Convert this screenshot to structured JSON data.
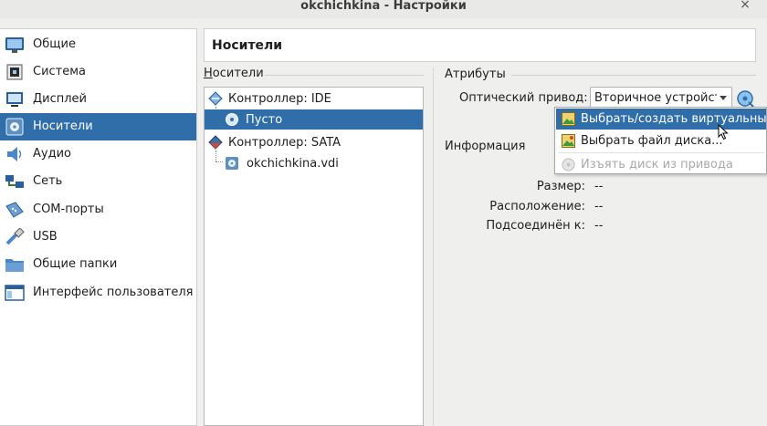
{
  "window": {
    "title": "okchichkina - Настройки",
    "close_glyph": "×"
  },
  "sidebar": {
    "items": [
      {
        "label": "Общие",
        "icon": "general-icon"
      },
      {
        "label": "Система",
        "icon": "system-icon"
      },
      {
        "label": "Дисплей",
        "icon": "display-icon"
      },
      {
        "label": "Носители",
        "icon": "storage-icon",
        "selected": true
      },
      {
        "label": "Аудио",
        "icon": "audio-icon"
      },
      {
        "label": "Сеть",
        "icon": "network-icon"
      },
      {
        "label": "COM-порты",
        "icon": "serial-ports-icon"
      },
      {
        "label": "USB",
        "icon": "usb-icon"
      },
      {
        "label": "Общие папки",
        "icon": "shared-folders-icon"
      },
      {
        "label": "Интерфейс пользователя",
        "icon": "user-interface-icon"
      }
    ]
  },
  "page": {
    "title": "Носители"
  },
  "storage": {
    "section_label": "Носители",
    "tree": [
      {
        "label": "Контроллер: IDE",
        "type": "controller",
        "icon": "ide-controller-icon"
      },
      {
        "label": "Пусто",
        "type": "attachment",
        "icon": "optical-disc-icon",
        "selected": true
      },
      {
        "label": "Контроллер: SATA",
        "type": "controller",
        "icon": "sata-controller-icon"
      },
      {
        "label": "okchichkina.vdi",
        "type": "attachment",
        "icon": "hard-disk-icon"
      }
    ]
  },
  "attributes": {
    "section_label": "Атрибуты",
    "optical_drive_label": "Оптический привод:",
    "optical_drive_value": "Вторичное устройство IDE"
  },
  "dropdown_menu": {
    "items": [
      {
        "label": "Выбрать/создать виртуальный оптический диск...",
        "highlighted": true,
        "enabled": true,
        "icon": "choose-disk-icon"
      },
      {
        "label": "Выбрать файл диска...",
        "enabled": true,
        "icon": "disk-file-icon"
      },
      {
        "label": "Изъять диск из привода",
        "enabled": false,
        "icon": "eject-disk-icon"
      }
    ]
  },
  "information": {
    "section_label": "Информация",
    "rows": [
      {
        "key": "Размер:",
        "value": "--"
      },
      {
        "key": "Расположение:",
        "value": "--"
      },
      {
        "key": "Подсоединён к:",
        "value": "--"
      }
    ]
  },
  "colors": {
    "selection": "#2f6ea9",
    "window_bg": "#efefed"
  }
}
